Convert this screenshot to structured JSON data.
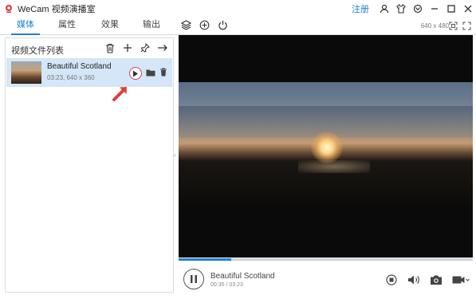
{
  "window": {
    "title": "WeCam 视频演播室",
    "register_label": "注册",
    "title_icons": [
      "user-icon",
      "shirt-icon",
      "settings-icon",
      "minimize-icon",
      "maximize-icon",
      "close-icon"
    ]
  },
  "tabs": [
    {
      "label": "媒体",
      "active": true
    },
    {
      "label": "属性",
      "active": false
    },
    {
      "label": "效果",
      "active": false
    },
    {
      "label": "输出",
      "active": false
    }
  ],
  "toolbar_icons": [
    "layers-icon",
    "add-circle-icon",
    "power-icon"
  ],
  "resolution_label": "640 x 480",
  "file_list": {
    "title": "视频文件列表",
    "tool_icons": [
      "delete-icon",
      "add-icon",
      "pin-icon",
      "arrow-right-icon"
    ],
    "items": [
      {
        "name": "Beautiful Scotland",
        "meta": "03:23, 640 x 360"
      }
    ]
  },
  "player": {
    "title": "Beautiful Scotland",
    "time": "00:35 / 03:23",
    "progress": 0.18
  },
  "colors": {
    "accent": "#1e7fd6",
    "highlight_row": "#d4e6f7",
    "arrow_red": "#e03b3b"
  }
}
